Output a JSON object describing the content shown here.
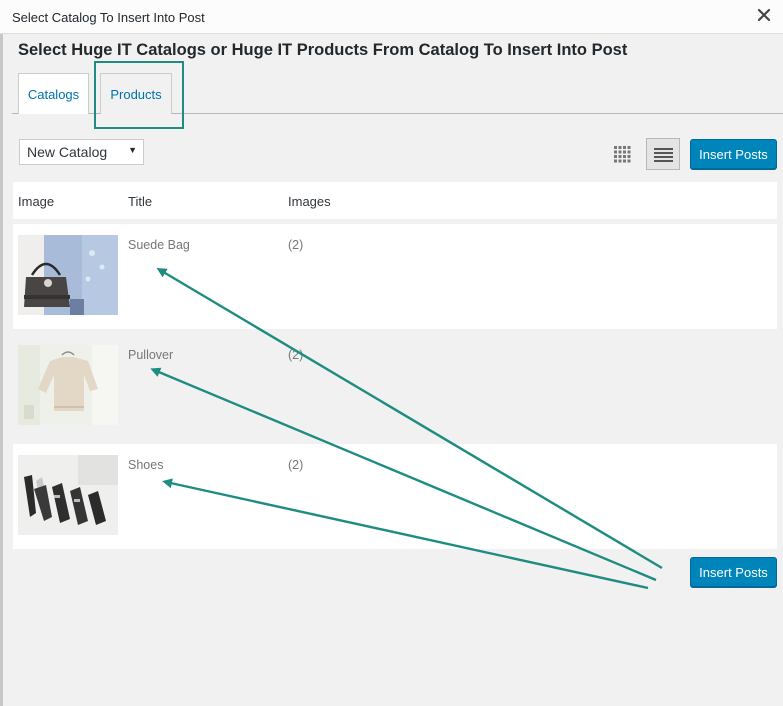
{
  "dialog": {
    "title": "Select Catalog To Insert Into Post",
    "close_icon": "close-icon"
  },
  "heading": "Select Huge IT Catalogs or Huge IT Products From Catalog To Insert Into Post",
  "tabs": [
    {
      "label": "Catalogs",
      "active": false
    },
    {
      "label": "Products",
      "active": true
    }
  ],
  "toolbar": {
    "catalog_select": "New Catalog",
    "grid_view_icon": "grid-view-icon",
    "list_view_icon": "list-view-icon",
    "insert_label": "Insert Posts"
  },
  "table": {
    "headers": [
      "Image",
      "Title",
      "Images"
    ],
    "rows": [
      {
        "title": "Suede Bag",
        "images": "(2)"
      },
      {
        "title": "Pullover",
        "images": "(2)"
      },
      {
        "title": "Shoes",
        "images": "(2)"
      }
    ]
  },
  "footer": {
    "insert_label": "Insert Posts"
  },
  "colors": {
    "accent": "#0085ba",
    "annotation": "#1e8c80",
    "link": "#0073aa"
  }
}
